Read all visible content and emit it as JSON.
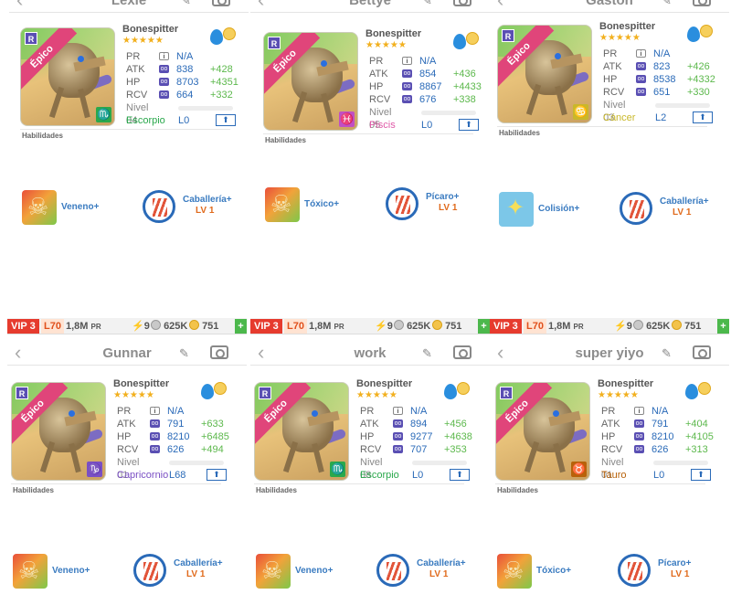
{
  "topbar": {
    "vip": "VIP 3",
    "level": "L70",
    "pr": "1,8M",
    "pr_unit": "PR",
    "energy": "9",
    "stones": "625K",
    "coins": "751",
    "add": "+"
  },
  "labels": {
    "pr": "PR",
    "atk": "ATK",
    "hp": "HP",
    "rcv": "RCV",
    "habilidades": "Habilidades",
    "rarity": "Épico",
    "rank": "R",
    "info": "i",
    "up": "⬆",
    "stars": "★★★★★",
    "stat_icon": "oo"
  },
  "panels": [
    {
      "player": "Lexie",
      "dino": "Bonespitter",
      "pr": "N/A",
      "atk": "838",
      "atk_bonus": "+428",
      "hp": "8703",
      "hp_bonus": "+4351",
      "rcv": "664",
      "rcv_bonus": "+332",
      "nivel": "Nivel 04",
      "sign": "Escorpio",
      "sign_color": "#2aa84c",
      "zodiac_glyph": "♏",
      "zodiac_bg": "#2aa84c",
      "lv": "L0",
      "skill": "Veneno+",
      "skill_icon": "skull-icon",
      "leader": "Caballería+",
      "leader_lv": "LV 1"
    },
    {
      "player": "Bettye",
      "dino": "Bonespitter",
      "pr": "N/A",
      "atk": "854",
      "atk_bonus": "+436",
      "hp": "8867",
      "hp_bonus": "+4433",
      "rcv": "676",
      "rcv_bonus": "+338",
      "nivel": "Nivel 05",
      "sign": "Piscis",
      "sign_color": "#e05aa8",
      "zodiac_glyph": "♓",
      "zodiac_bg": "#c14fc4",
      "lv": "L0",
      "skill": "Tóxico+",
      "skill_icon": "skull-icon",
      "leader": "Pícaro+",
      "leader_lv": "LV 1"
    },
    {
      "player": "Gaston",
      "dino": "Bonespitter",
      "pr": "N/A",
      "atk": "823",
      "atk_bonus": "+426",
      "hp": "8538",
      "hp_bonus": "+4332",
      "rcv": "651",
      "rcv_bonus": "+330",
      "nivel": "Nivel 03",
      "sign": "Cáncer",
      "sign_color": "#c9b82a",
      "zodiac_glyph": "♋",
      "zodiac_bg": "#c9b82a",
      "lv": "L2",
      "skill": "Colisión+",
      "skill_icon": "crash-icon",
      "leader": "Caballería+",
      "leader_lv": "LV 1"
    },
    {
      "player": "Gunnar",
      "dino": "Bonespitter",
      "pr": "N/A",
      "atk": "791",
      "atk_bonus": "+633",
      "hp": "8210",
      "hp_bonus": "+6485",
      "rcv": "626",
      "rcv_bonus": "+494",
      "nivel": "Nivel 01",
      "sign": "Capricornio",
      "sign_color": "#7a4fc4",
      "zodiac_glyph": "♑",
      "zodiac_bg": "#7a4fc4",
      "lv": "L68",
      "skill": "Veneno+",
      "skill_icon": "skull-icon",
      "leader": "Caballería+",
      "leader_lv": "LV 1"
    },
    {
      "player": "work",
      "dino": "Bonespitter",
      "pr": "N/A",
      "atk": "894",
      "atk_bonus": "+456",
      "hp": "9277",
      "hp_bonus": "+4638",
      "rcv": "707",
      "rcv_bonus": "+353",
      "nivel": "Nivel 08",
      "sign": "Escorpio",
      "sign_color": "#2aa84c",
      "zodiac_glyph": "♏",
      "zodiac_bg": "#2aa84c",
      "lv": "L0",
      "skill": "Veneno+",
      "skill_icon": "skull-icon",
      "leader": "Caballería+",
      "leader_lv": "LV 1"
    },
    {
      "player": "super yiyo",
      "dino": "Bonespitter",
      "pr": "N/A",
      "atk": "791",
      "atk_bonus": "+404",
      "hp": "8210",
      "hp_bonus": "+4105",
      "rcv": "626",
      "rcv_bonus": "+313",
      "nivel": "Nivel 01",
      "sign": "Tauro",
      "sign_color": "#b8620a",
      "zodiac_glyph": "♉",
      "zodiac_bg": "#b8620a",
      "lv": "L0",
      "skill": "Tóxico+",
      "skill_icon": "skull-icon",
      "leader": "Pícaro+",
      "leader_lv": "LV 1"
    }
  ]
}
